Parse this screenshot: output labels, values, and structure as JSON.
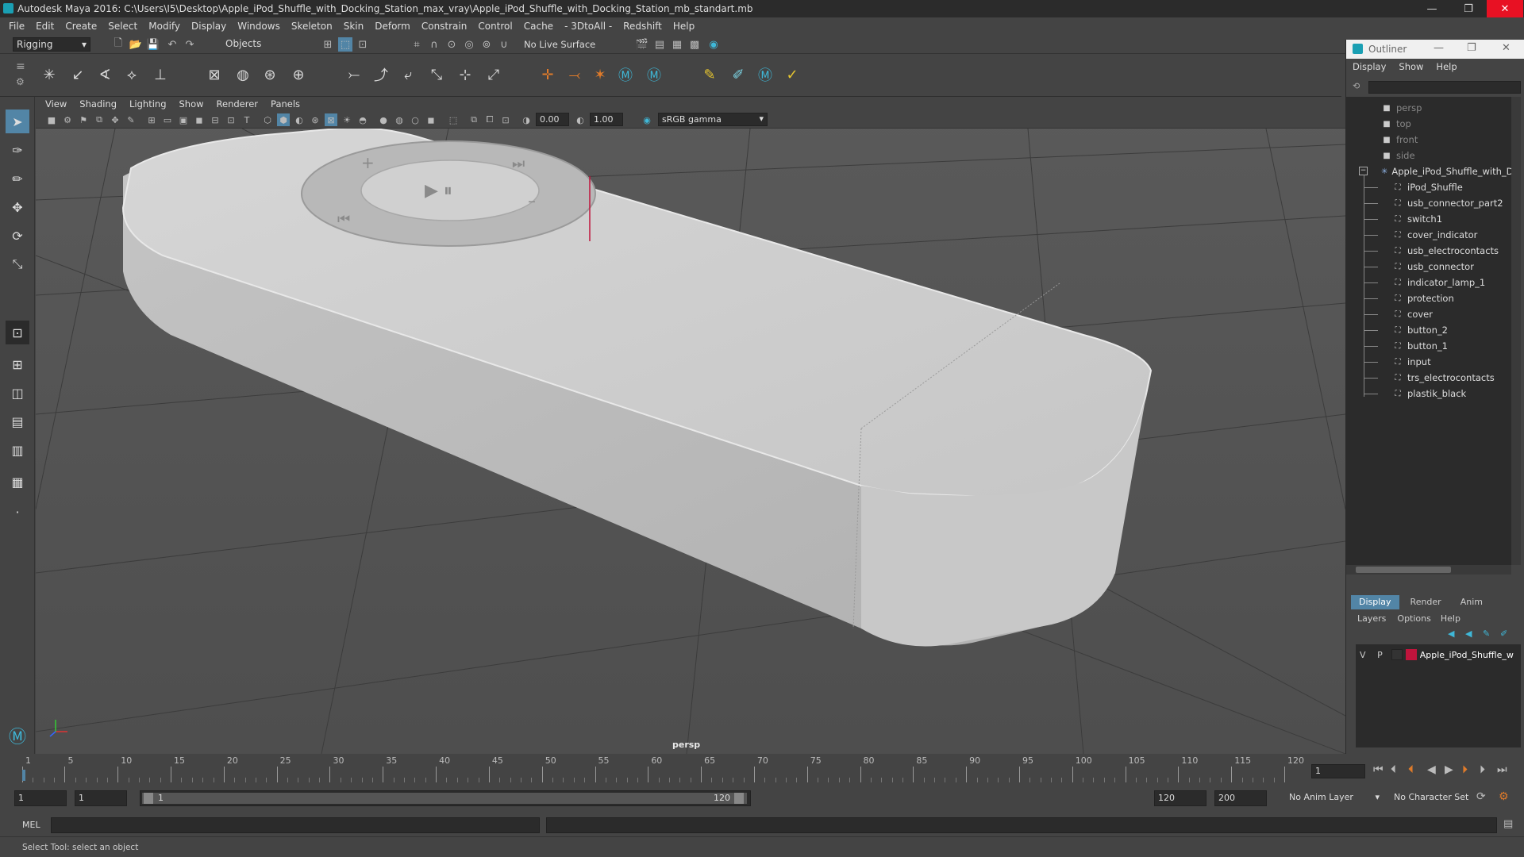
{
  "window": {
    "title": "Autodesk Maya 2016: C:\\Users\\I5\\Desktop\\Apple_iPod_Shuffle_with_Docking_Station_max_vray\\Apple_iPod_Shuffle_with_Docking_Station_mb_standart.mb",
    "minimize": "—",
    "restore": "❐",
    "close": "✕"
  },
  "menubar": [
    "File",
    "Edit",
    "Create",
    "Select",
    "Modify",
    "Display",
    "Windows",
    "Skeleton",
    "Skin",
    "Deform",
    "Constrain",
    "Control",
    "Cache",
    "- 3DtoAll -",
    "Redshift",
    "Help"
  ],
  "statusline": {
    "menuset": "Rigging",
    "selection_mode": "Objects",
    "live_surface": "No Live Surface"
  },
  "viewport": {
    "menu": [
      "View",
      "Shading",
      "Lighting",
      "Show",
      "Renderer",
      "Panels"
    ],
    "exposure": "0.00",
    "gamma": "1.00",
    "color_space": "sRGB gamma",
    "camera_label": "persp"
  },
  "outliner": {
    "title": "Outliner",
    "menu": [
      "Display",
      "Show",
      "Help"
    ],
    "items": [
      {
        "label": "persp",
        "type": "camera",
        "dim": true,
        "indent": 0
      },
      {
        "label": "top",
        "type": "camera",
        "dim": true,
        "indent": 0
      },
      {
        "label": "front",
        "type": "camera",
        "dim": true,
        "indent": 0
      },
      {
        "label": "side",
        "type": "camera",
        "dim": true,
        "indent": 0
      },
      {
        "label": "Apple_iPod_Shuffle_with_Dc",
        "type": "group",
        "dim": false,
        "indent": 0
      },
      {
        "label": "iPod_Shuffle",
        "type": "mesh",
        "dim": false,
        "indent": 1
      },
      {
        "label": "usb_connector_part2",
        "type": "mesh",
        "dim": false,
        "indent": 1
      },
      {
        "label": "switch1",
        "type": "mesh",
        "dim": false,
        "indent": 1
      },
      {
        "label": "cover_indicator",
        "type": "mesh",
        "dim": false,
        "indent": 1
      },
      {
        "label": "usb_electrocontacts",
        "type": "mesh",
        "dim": false,
        "indent": 1
      },
      {
        "label": "usb_connector",
        "type": "mesh",
        "dim": false,
        "indent": 1
      },
      {
        "label": "indicator_lamp_1",
        "type": "mesh",
        "dim": false,
        "indent": 1
      },
      {
        "label": "protection",
        "type": "mesh",
        "dim": false,
        "indent": 1
      },
      {
        "label": "cover",
        "type": "mesh",
        "dim": false,
        "indent": 1
      },
      {
        "label": "button_2",
        "type": "mesh",
        "dim": false,
        "indent": 1
      },
      {
        "label": "button_1",
        "type": "mesh",
        "dim": false,
        "indent": 1
      },
      {
        "label": "input",
        "type": "mesh",
        "dim": false,
        "indent": 1
      },
      {
        "label": "trs_electrocontacts",
        "type": "mesh",
        "dim": false,
        "indent": 1
      },
      {
        "label": "plastik_black",
        "type": "mesh",
        "dim": false,
        "indent": 1
      }
    ]
  },
  "layers": {
    "tabs": [
      "Display",
      "Render",
      "Anim"
    ],
    "menu": [
      "Layers",
      "Options",
      "Help"
    ],
    "layer": {
      "v": "V",
      "p": "P",
      "name": "Apple_iPod_Shuffle_w",
      "color": "#c0143c"
    }
  },
  "timeline": {
    "ticks": [
      "1",
      "5",
      "10",
      "15",
      "20",
      "25",
      "30",
      "35",
      "40",
      "45",
      "50",
      "55",
      "60",
      "65",
      "70",
      "75",
      "80",
      "85",
      "90",
      "95",
      "100",
      "105",
      "110",
      "115",
      "120"
    ],
    "current_frame": "1"
  },
  "range": {
    "start": "1",
    "playback_start": "1",
    "slider_start": "1",
    "slider_end": "120",
    "playback_end": "120",
    "end": "200",
    "anim_layer": "No Anim Layer",
    "character_set": "No Character Set"
  },
  "mel": {
    "label": "MEL"
  },
  "helpline": "Select Tool: select an object",
  "colors": {
    "accent": "#5285a6",
    "selected_tool": "#5285a6",
    "close_hover": "#e81123"
  }
}
